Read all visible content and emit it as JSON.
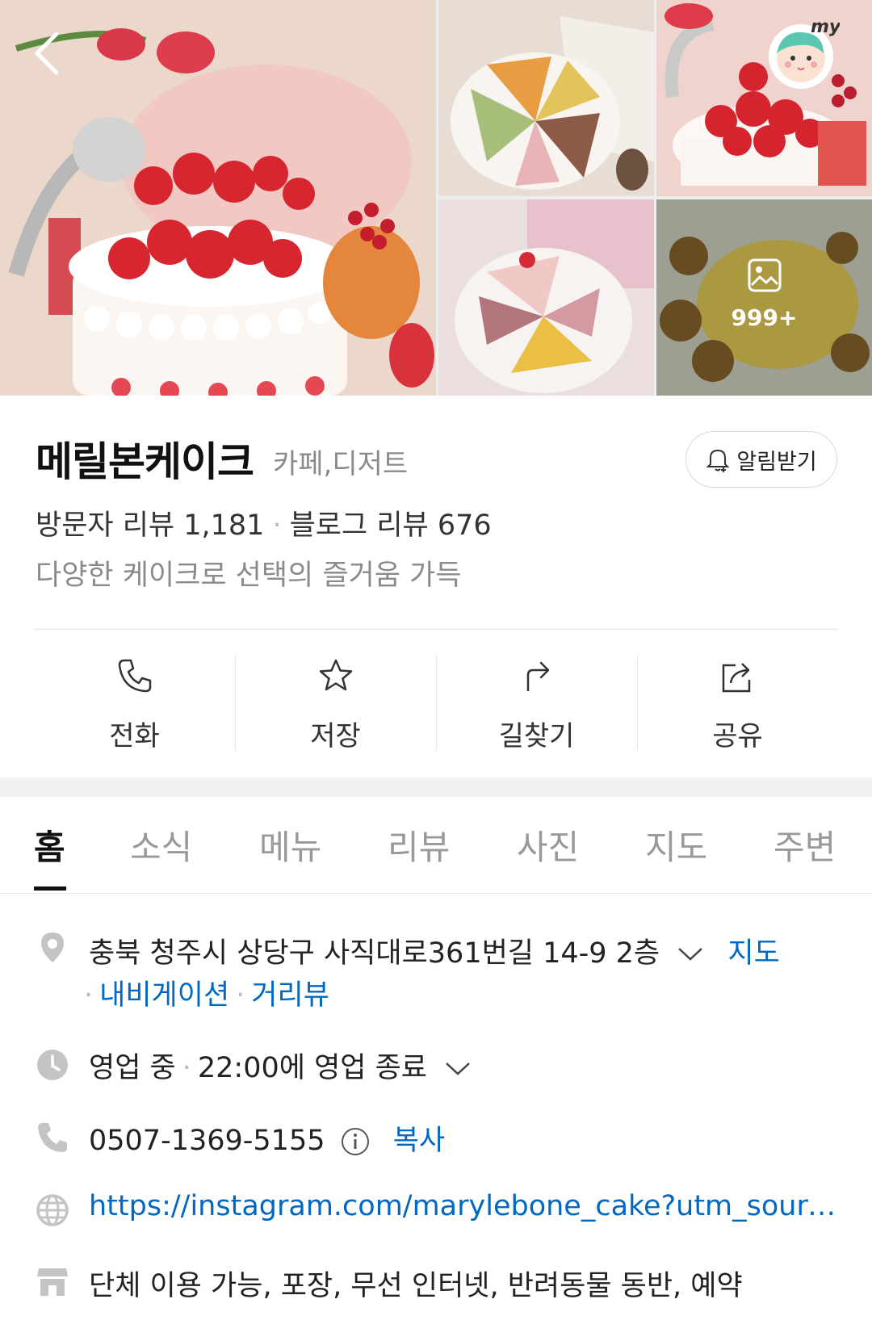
{
  "gallery": {
    "more_count": "999+"
  },
  "place": {
    "name": "메릴본케이크",
    "category": "카페,디저트",
    "notify_label": "알림받기",
    "visitor_review": "방문자 리뷰 1,181",
    "blog_review": "블로그 리뷰 676",
    "description": "다양한 케이크로 선택의 즐거움 가득"
  },
  "actions": [
    {
      "label": "전화",
      "icon": "phone-icon"
    },
    {
      "label": "저장",
      "icon": "star-icon"
    },
    {
      "label": "길찾기",
      "icon": "directions-icon"
    },
    {
      "label": "공유",
      "icon": "share-icon"
    }
  ],
  "tabs": [
    "홈",
    "소식",
    "메뉴",
    "리뷰",
    "사진",
    "지도",
    "주변"
  ],
  "info": {
    "address": "충북 청주시 상당구 사직대로361번길 14-9 2층",
    "map_link": "지도",
    "navigation_link": "내비게이션",
    "streetview_link": "거리뷰",
    "status": "영업 중",
    "hours": "22:00에 영업 종료",
    "phone": "0507-1369-5155",
    "copy_label": "복사",
    "website": "https://instagram.com/marylebone_cake?utm_source…",
    "amenities": "단체 이용 가능, 포장, 무선 인터넷, 반려동물 동반, 예약"
  },
  "colors": {
    "link_blue": "#0068c3",
    "muted": "#8a8a8a"
  }
}
